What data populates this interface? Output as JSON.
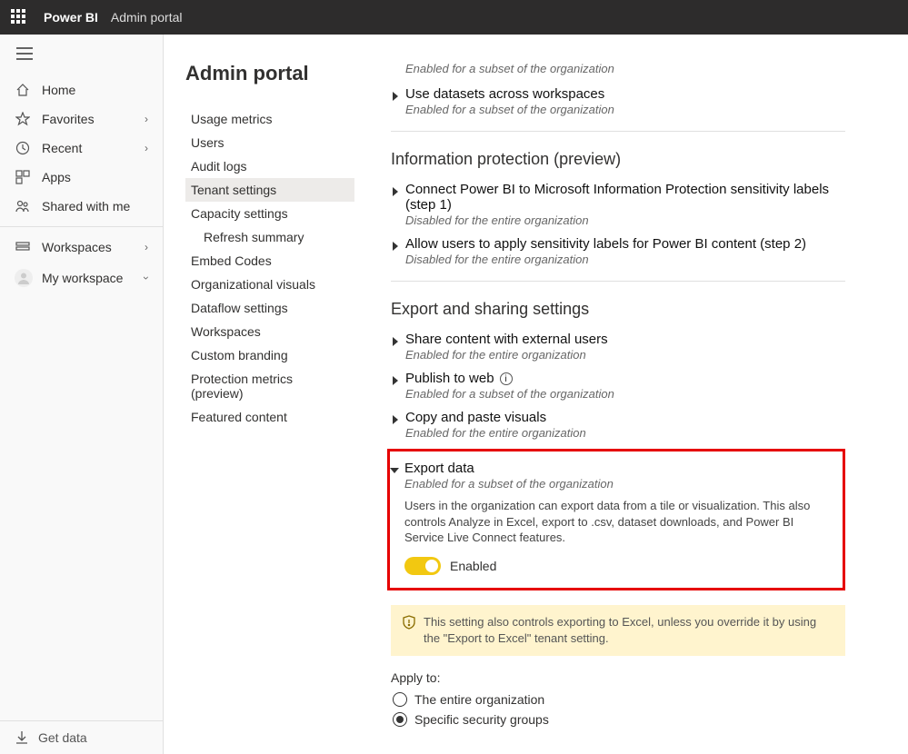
{
  "topbar": {
    "brand": "Power BI",
    "section": "Admin portal"
  },
  "leftnav": {
    "home": "Home",
    "favorites": "Favorites",
    "recent": "Recent",
    "apps": "Apps",
    "shared": "Shared with me",
    "workspaces": "Workspaces",
    "myworkspace": "My workspace",
    "getdata": "Get data"
  },
  "admin": {
    "title": "Admin portal",
    "menu": {
      "usage": "Usage metrics",
      "users": "Users",
      "audit": "Audit logs",
      "tenant": "Tenant settings",
      "capacity": "Capacity settings",
      "refresh": "Refresh summary",
      "embed": "Embed Codes",
      "orgvis": "Organizational visuals",
      "dataflow": "Dataflow settings",
      "workspaces": "Workspaces",
      "branding": "Custom branding",
      "protection": "Protection metrics (preview)",
      "featured": "Featured content"
    }
  },
  "settings": {
    "subset_enabled": "Enabled for a subset of the organization",
    "entire_enabled": "Enabled for the entire organization",
    "entire_disabled": "Disabled for the entire organization",
    "cross_ws": "Use datasets across workspaces",
    "info_protection_head": "Information protection (preview)",
    "connect_mip": "Connect Power BI to Microsoft Information Protection sensitivity labels (step 1)",
    "apply_labels": "Allow users to apply sensitivity labels for Power BI content (step 2)",
    "export_head": "Export and sharing settings",
    "share_external": "Share content with external users",
    "publish_web": "Publish to web",
    "copy_paste": "Copy and paste visuals",
    "export_data": {
      "title": "Export data",
      "desc": "Users in the organization can export data from a tile or visualization. This also controls Analyze in Excel, export to .csv, dataset downloads, and Power BI Service Live Connect features.",
      "toggle_label": "Enabled"
    },
    "note": "This setting also controls exporting to Excel, unless you override it by using the \"Export to Excel\" tenant setting.",
    "apply_to": "Apply to:",
    "entire_org": "The entire organization",
    "specific_groups": "Specific security groups"
  }
}
